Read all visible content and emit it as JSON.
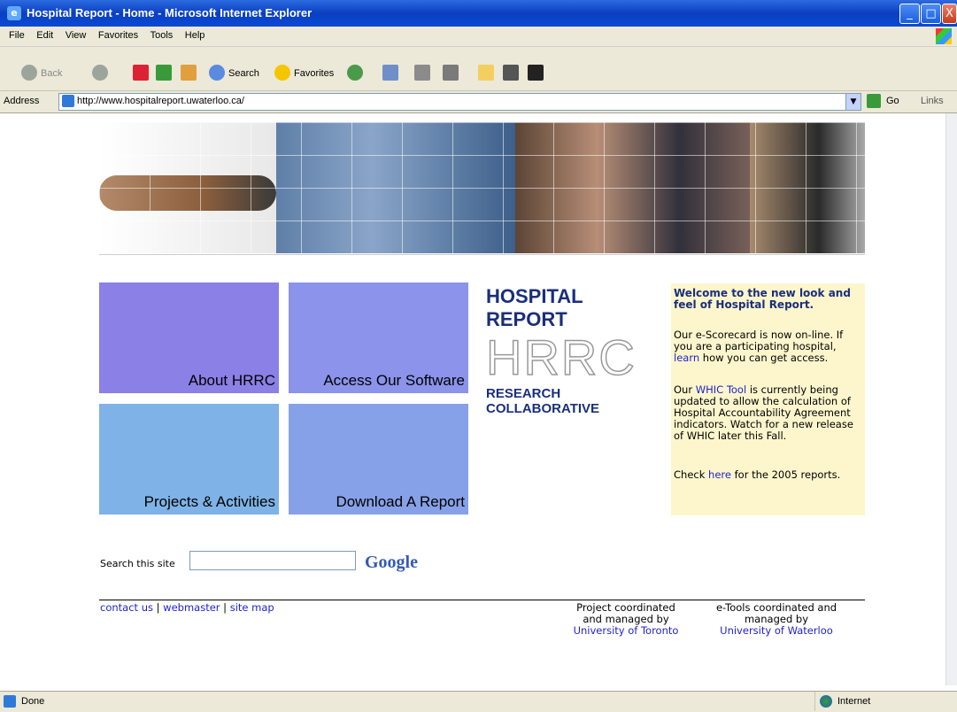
{
  "window": {
    "title": "Hospital Report - Home - Microsoft Internet Explorer",
    "minimize": "_",
    "maximize": "□",
    "close": "X"
  },
  "menu": [
    "File",
    "Edit",
    "View",
    "Favorites",
    "Tools",
    "Help"
  ],
  "toolbar": {
    "back": "Back",
    "search": "Search",
    "favorites": "Favorites"
  },
  "address": {
    "label": "Address",
    "url": "http://www.hospitalreport.uwaterloo.ca/",
    "go": "Go",
    "links": "Links"
  },
  "tiles": {
    "about": "About HRRC",
    "software": "Access Our Software",
    "projects": "Projects & Activities",
    "download": "Download A Report"
  },
  "logo": {
    "line1": "HOSPITAL REPORT",
    "line2": "HRRC",
    "line3": "RESEARCH COLLABORATIVE"
  },
  "welcome": {
    "heading": "Welcome to the new look and feel of Hospital Report.",
    "p1_before": "Our e-Scorecard is now on-line. If you are a participating hospital, ",
    "p1_link": "learn",
    "p1_after": " how you can get access.",
    "p2_before": "Our ",
    "p2_link": "WHIC Tool",
    "p2_after": " is currently being updated to allow the calculation of Hospital Accountability Agreement indicators. Watch for a new release of WHIC later this Fall.",
    "p3_before": "Check ",
    "p3_link": "here",
    "p3_after": " for the 2005 reports."
  },
  "search": {
    "label": "Search this site",
    "value": "",
    "google": "Google"
  },
  "footer": {
    "contact": "contact us",
    "sep1": "|",
    "webmaster": "webmaster",
    "sep2": "|",
    "sitemap": "site map",
    "col1_line1": "Project coordinated",
    "col1_line2": "and managed by",
    "col1_link": "University of Toronto",
    "col2_line1": "e-Tools coordinated and",
    "col2_line2": "managed by",
    "col2_link": "University of Waterloo"
  },
  "status": {
    "text": "Done",
    "zone": "Internet"
  },
  "colors": {
    "tile_about": "#8a80e6",
    "tile_software": "#8b93ea",
    "tile_projects": "#7fb2e6",
    "tile_download": "#87a1e8",
    "welcome_bg": "#fdf6cd",
    "link": "#2222cc"
  }
}
